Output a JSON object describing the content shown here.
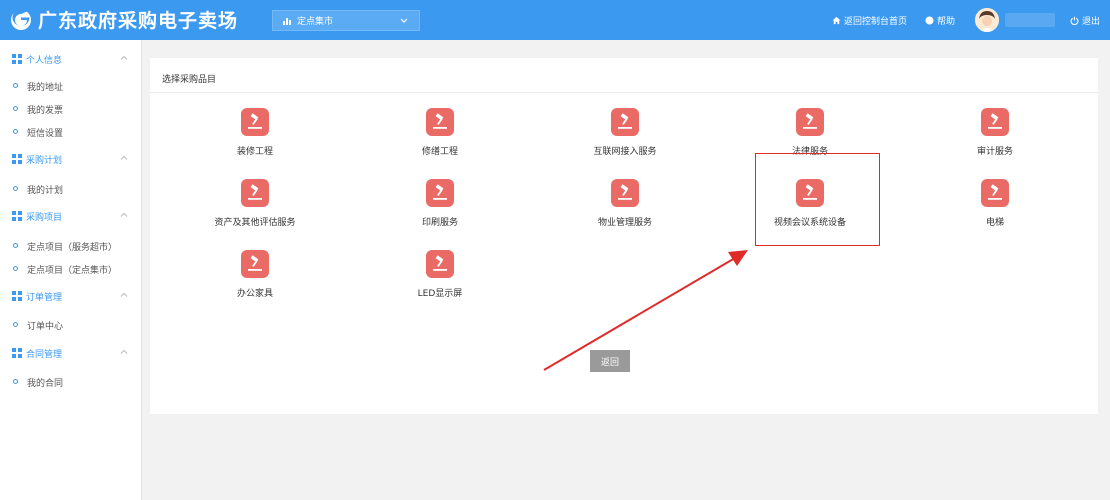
{
  "header": {
    "logo_text": "广东政府采购电子卖场",
    "selector_label": "定点集市",
    "home_link": "返回控制台首页",
    "help_link": "帮助",
    "logout_link": "退出"
  },
  "sidebar": {
    "groups": [
      {
        "title": "个人信息",
        "items": [
          "我的地址",
          "我的发票",
          "短信设置"
        ]
      },
      {
        "title": "采购计划",
        "items": [
          "我的计划"
        ]
      },
      {
        "title": "采购项目",
        "items": [
          "定点项目（服务超市）",
          "定点项目（定点集市）"
        ]
      },
      {
        "title": "订单管理",
        "items": [
          "订单中心"
        ]
      },
      {
        "title": "合同管理",
        "items": [
          "我的合同"
        ]
      }
    ]
  },
  "main": {
    "title": "选择采购品目",
    "tiles": [
      {
        "label": "装修工程"
      },
      {
        "label": "修缮工程"
      },
      {
        "label": "互联网接入服务"
      },
      {
        "label": "法律服务"
      },
      {
        "label": "审计服务"
      },
      {
        "label": "资产及其他评估服务"
      },
      {
        "label": "印刷服务"
      },
      {
        "label": "物业管理服务"
      },
      {
        "label": "视频会议系统设备"
      },
      {
        "label": "电梯"
      },
      {
        "label": "办公家具"
      },
      {
        "label": "LED显示屏"
      }
    ],
    "back_button": "返回"
  },
  "colors": {
    "header_bg": "#3b99f0",
    "tile_bg": "#ea6b66",
    "annotation": "#e02b2b",
    "back_button_bg": "#9a9a9a"
  }
}
